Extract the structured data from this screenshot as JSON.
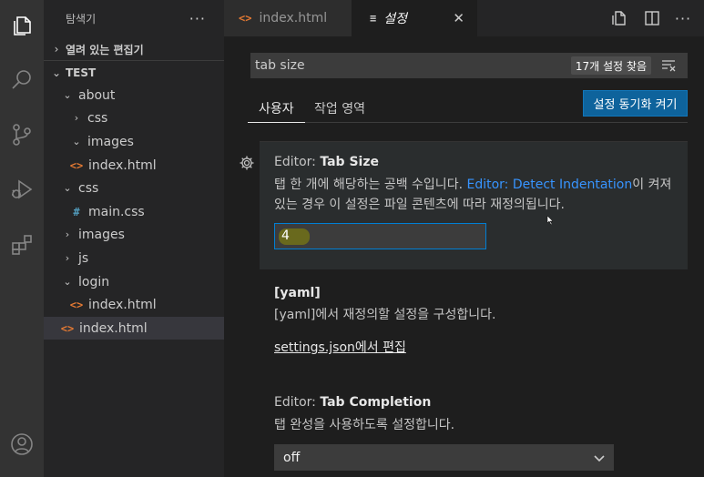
{
  "sidebar": {
    "title": "탐색기",
    "more": "···",
    "open_editors": "열려 있는 편집기",
    "workspace": "TEST",
    "tree": [
      {
        "label": "about",
        "kind": "folder",
        "open": true
      },
      {
        "label": "css",
        "kind": "folder",
        "open": false
      },
      {
        "label": "images",
        "kind": "folder",
        "open": true
      },
      {
        "label": "index.html",
        "kind": "html"
      },
      {
        "label": "css",
        "kind": "folder",
        "open": true
      },
      {
        "label": "main.css",
        "kind": "css"
      },
      {
        "label": "images",
        "kind": "folder",
        "open": false
      },
      {
        "label": "js",
        "kind": "folder",
        "open": false
      },
      {
        "label": "login",
        "kind": "folder",
        "open": true
      },
      {
        "label": "index.html",
        "kind": "html"
      },
      {
        "label": "index.html",
        "kind": "html"
      }
    ]
  },
  "tabs": [
    {
      "label": "index.html",
      "icon": "<>"
    },
    {
      "label": "설정",
      "icon": "≡",
      "close": "✕"
    }
  ],
  "settings": {
    "search_value": "tab size",
    "result_count": "17개 설정 찾음",
    "scope_tabs": [
      "사용자",
      "작업 영역"
    ],
    "sync_button": "설정 동기화 켜기",
    "items": [
      {
        "category": "Editor: ",
        "name": "Tab Size",
        "desc_before": "탭 한 개에 해당하는 공백 수입니다. ",
        "desc_link": "Editor: Detect Indentation",
        "desc_after": "이 켜져",
        "desc_line2": "있는 경우 이 설정은 파일 콘텐츠에 따라 재정의됩니다.",
        "value": "4"
      },
      {
        "name": "[yaml]",
        "desc": "[yaml]에서 재정의할 설정을 구성합니다.",
        "edit_link": "settings.json에서 편집"
      },
      {
        "category": "Editor: ",
        "name": "Tab Completion",
        "desc": "탭 완성을 사용하도록 설정합니다.",
        "value": "off"
      }
    ]
  }
}
